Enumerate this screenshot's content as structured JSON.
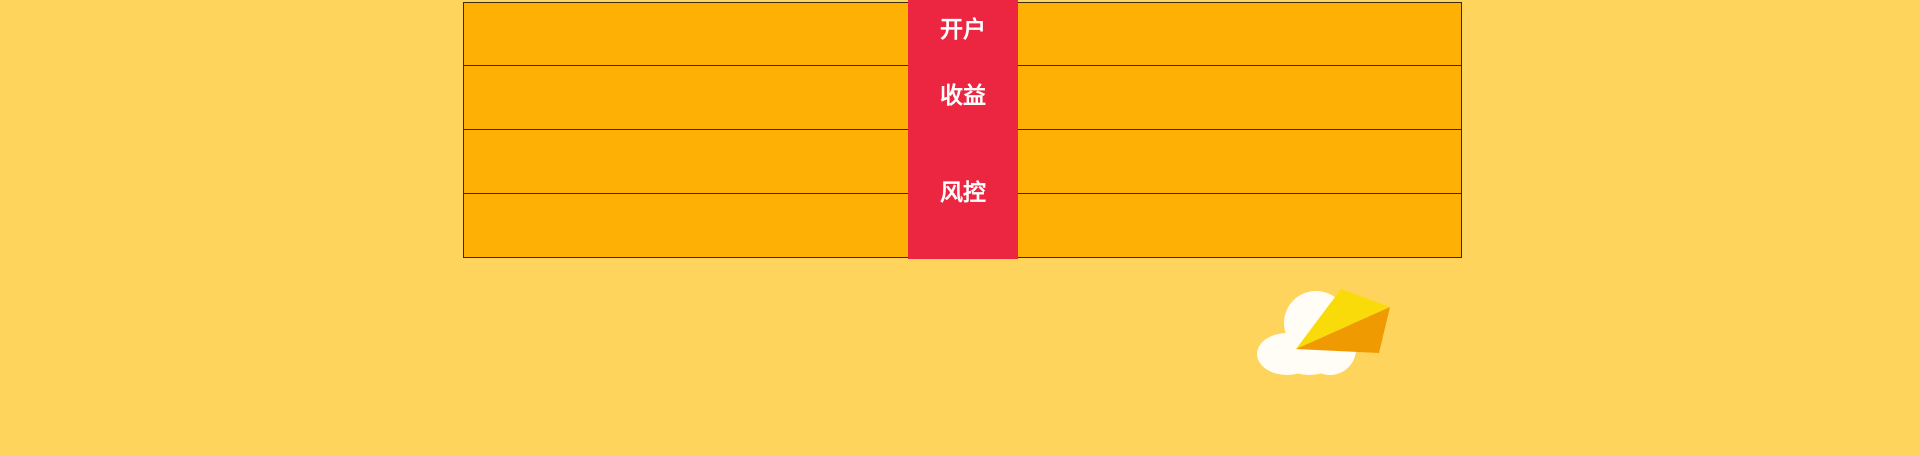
{
  "center_band": {
    "labels": [
      "开户",
      "收益",
      "风控"
    ]
  },
  "colors": {
    "page_background": "#FFD45C",
    "table_fill": "#FFB005",
    "table_border": "#3a2a10",
    "band": "#EC2540",
    "band_text": "#FFFFFF"
  },
  "logo": {
    "icon": "cloud-kite-icon"
  }
}
